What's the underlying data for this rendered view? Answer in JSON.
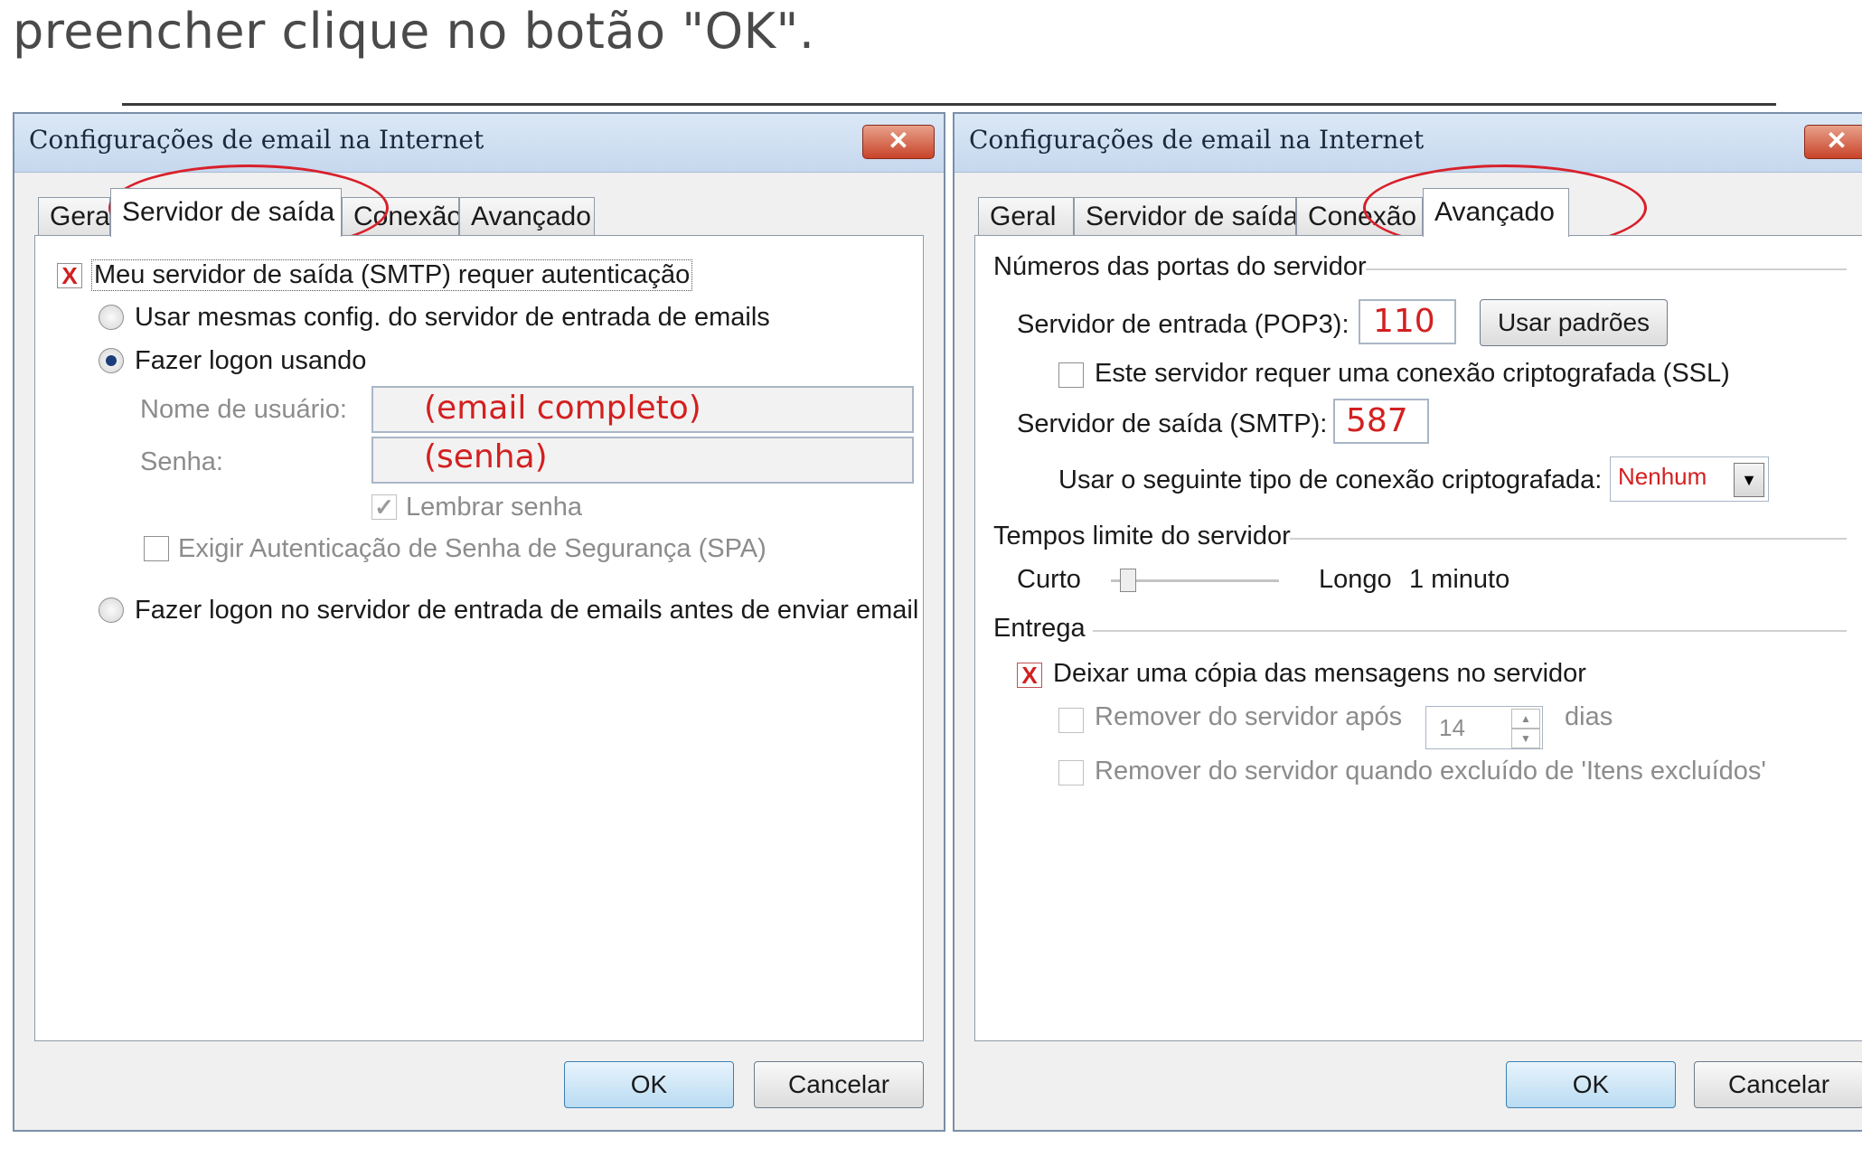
{
  "caption": "preencher clique no botão \"OK\".",
  "dialog_left": {
    "title": "Configurações de email na Internet",
    "close": "✕",
    "tabs": [
      "Geral",
      "Servidor de saída",
      "Conexão",
      "Avançado"
    ],
    "active_tab": "Servidor de saída",
    "smtp_auth_checkbox": {
      "label": "Meu servidor de saída (SMTP) requer autenticação",
      "checked": true,
      "mark": "X"
    },
    "radio_same": "Usar mesmas config. do servidor de entrada de emails",
    "radio_logon": "Fazer logon usando",
    "username_label": "Nome de usuário:",
    "username_value": "(email completo)",
    "password_label": "Senha:",
    "password_value": "(senha)",
    "remember_label": "Lembrar senha",
    "remember_mark": "✓",
    "spa_label": "Exigir Autenticação de Senha de Segurança (SPA)",
    "radio_before_send": "Fazer logon no servidor de entrada de emails antes de enviar email",
    "ok": "OK",
    "cancel": "Cancelar"
  },
  "dialog_right": {
    "title": "Configurações de email na Internet",
    "close": "✕",
    "tabs": [
      "Geral",
      "Servidor de saída",
      "Conexão",
      "Avançado"
    ],
    "active_tab": "Avançado",
    "ports_header": "Números das portas do servidor",
    "pop3_label": "Servidor de entrada (POP3):",
    "pop3_value": "110",
    "defaults_button": "Usar padrões",
    "ssl_label": "Este servidor requer uma conexão criptografada (SSL)",
    "smtp_label": "Servidor de saída (SMTP):",
    "smtp_value": "587",
    "encryption_label": "Usar o seguinte tipo de conexão criptografada:",
    "encryption_value": "Nenhum",
    "timeouts_header": "Tempos limite do servidor",
    "short_label": "Curto",
    "long_label": "Longo",
    "timeout_value": "1 minuto",
    "delivery_header": "Entrega",
    "leave_copy_label": "Deixar uma cópia das mensagens no servidor",
    "leave_copy_mark": "X",
    "remove_after_label": "Remover do servidor após",
    "remove_days_value": "14",
    "days_label": "dias",
    "remove_deleted_label": "Remover do servidor quando excluído de 'Itens excluídos'",
    "ok": "OK",
    "cancel": "Cancelar"
  },
  "colors": {
    "annotation": "#d8202a",
    "accent_value": "#d32020"
  }
}
